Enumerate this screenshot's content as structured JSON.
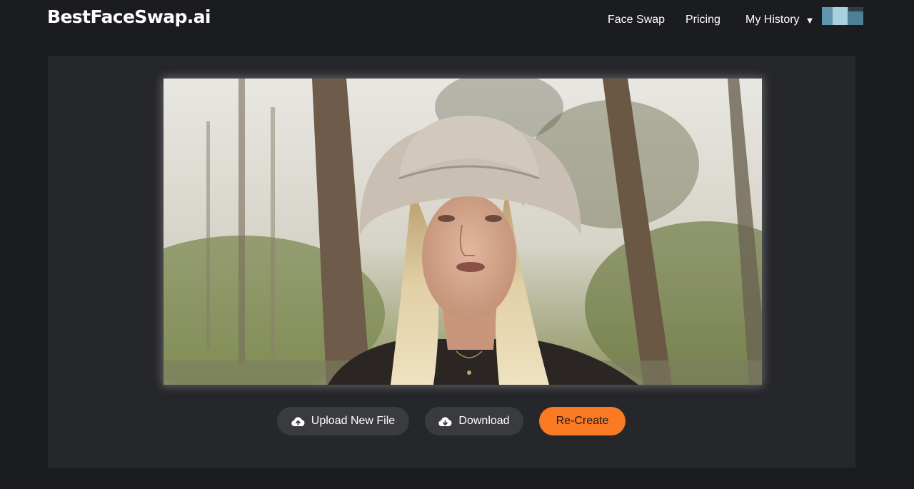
{
  "header": {
    "logo": "BestFaceSwap.ai",
    "nav": {
      "face_swap": "Face Swap",
      "pricing": "Pricing",
      "my_history": "My History",
      "history_caret": "▼"
    },
    "avatar_icon": "user-avatar"
  },
  "result": {
    "media_icon": "result-video-frame"
  },
  "actions": {
    "upload_label": "Upload New File",
    "upload_icon": "cloud-upload-icon",
    "download_label": "Download",
    "download_icon": "cloud-download-icon",
    "recreate_label": "Re-Create"
  },
  "colors": {
    "background": "#1b1c20",
    "panel": "#26272b",
    "button": "#3a3b40",
    "accent": "#fa7a23"
  }
}
